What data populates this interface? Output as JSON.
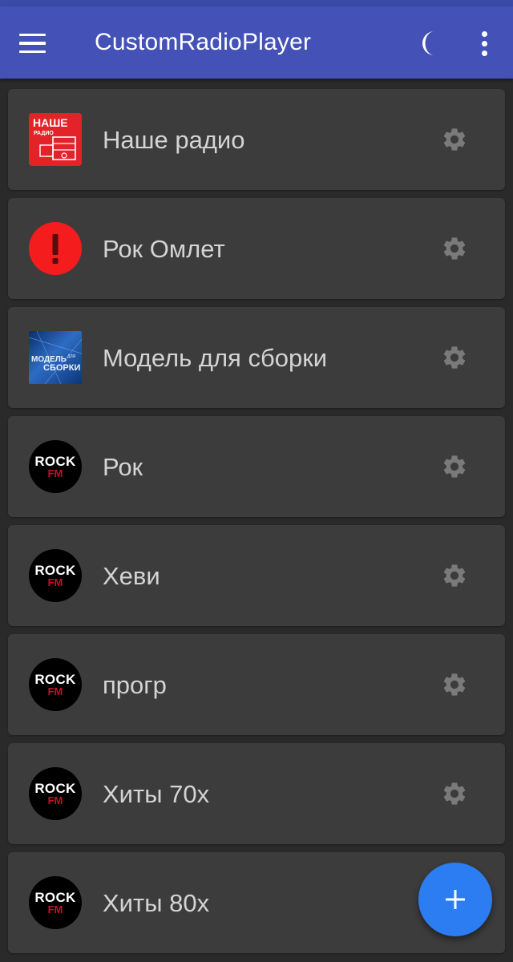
{
  "app_bar": {
    "title": "CustomRadioPlayer",
    "color": "#4452b8",
    "icons": {
      "menu": "hamburger-menu-icon",
      "theme": "moon-icon",
      "overflow": "more-vert-icon"
    }
  },
  "stations": [
    {
      "name": "Наше радио",
      "logo": "nashe-radio-logo",
      "logo_text_top": "НАШЕ",
      "logo_text_bottom": "РАДИО"
    },
    {
      "name": "Рок Омлет",
      "logo": "error-alert-icon"
    },
    {
      "name": "Модель для сборки",
      "logo": "model-dlya-sborki-logo",
      "logo_text_top": "МОДЕЛЬ",
      "logo_text_small": "ДЛЯ",
      "logo_text_bottom": "СБОРКИ"
    },
    {
      "name": "Рок",
      "logo": "rock-fm-logo",
      "logo_text_top": "ROCK",
      "logo_text_bottom": "FM"
    },
    {
      "name": "Хеви",
      "logo": "rock-fm-logo",
      "logo_text_top": "ROCK",
      "logo_text_bottom": "FM"
    },
    {
      "name": "прогр",
      "logo": "rock-fm-logo",
      "logo_text_top": "ROCK",
      "logo_text_bottom": "FM"
    },
    {
      "name": "Хиты 70х",
      "logo": "rock-fm-logo",
      "logo_text_top": "ROCK",
      "logo_text_bottom": "FM"
    },
    {
      "name": "Хиты 80х",
      "logo": "rock-fm-logo",
      "logo_text_top": "ROCK",
      "logo_text_bottom": "FM"
    }
  ],
  "fab": {
    "icon": "add-icon",
    "color": "#2c7cf2"
  }
}
